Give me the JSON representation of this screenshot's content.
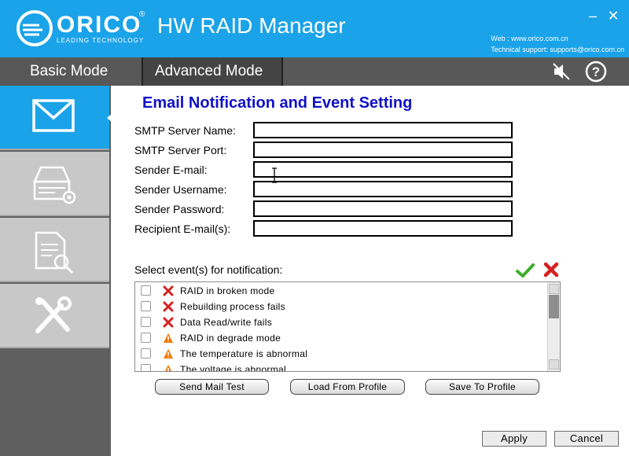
{
  "header": {
    "brand": "ORICO",
    "brand_tagline": "LEADING TECHNOLOGY",
    "app_title": "HW RAID Manager",
    "web": "Web : www.orico.com.cn",
    "support": "Technical support: supports@orico.com.cn",
    "window_controls": [
      "minimize",
      "close"
    ]
  },
  "modebar": {
    "basic_label": "Basic Mode",
    "advanced_label": "Advanced Mode",
    "active_mode": "Advanced Mode",
    "icons": [
      "mute-speaker-icon",
      "help-icon"
    ]
  },
  "sidebar": {
    "items": [
      {
        "icon": "envelope-icon",
        "active": true
      },
      {
        "icon": "disk-settings-icon",
        "active": false
      },
      {
        "icon": "document-search-icon",
        "active": false
      },
      {
        "icon": "tools-icon",
        "active": false
      }
    ]
  },
  "panel": {
    "title": "Email Notification and Event Setting"
  },
  "form": {
    "fields": [
      {
        "label": "SMTP Server Name:",
        "value": ""
      },
      {
        "label": "SMTP Server Port:",
        "value": ""
      },
      {
        "label": "Sender E-mail:",
        "value": ""
      },
      {
        "label": "Sender Username:",
        "value": ""
      },
      {
        "label": "Sender Password:",
        "value": ""
      },
      {
        "label": "Recipient E-mail(s):",
        "value": ""
      }
    ]
  },
  "events": {
    "label": "Select event(s) for notification:",
    "items": [
      {
        "text": "RAID in broken mode",
        "severity": "error",
        "checked": false
      },
      {
        "text": "Rebuilding process fails",
        "severity": "error",
        "checked": false
      },
      {
        "text": "Data Read/write fails",
        "severity": "error",
        "checked": false
      },
      {
        "text": "RAID in degrade mode",
        "severity": "warning",
        "checked": false
      },
      {
        "text": "The temperature is abnormal",
        "severity": "warning",
        "checked": false
      },
      {
        "text": "The voltage is abnormal",
        "severity": "warning",
        "checked": false
      }
    ]
  },
  "buttons": {
    "send_mail_test": "Send Mail Test",
    "load_profile": "Load From Profile",
    "save_profile": "Save To Profile",
    "apply": "Apply",
    "cancel": "Cancel"
  },
  "colors": {
    "accent_blue": "#1aa3e8",
    "title_blue": "#1010c8",
    "error_red": "#d42020",
    "warning_orange": "#f07b00",
    "check_green": "#3fae2a"
  }
}
